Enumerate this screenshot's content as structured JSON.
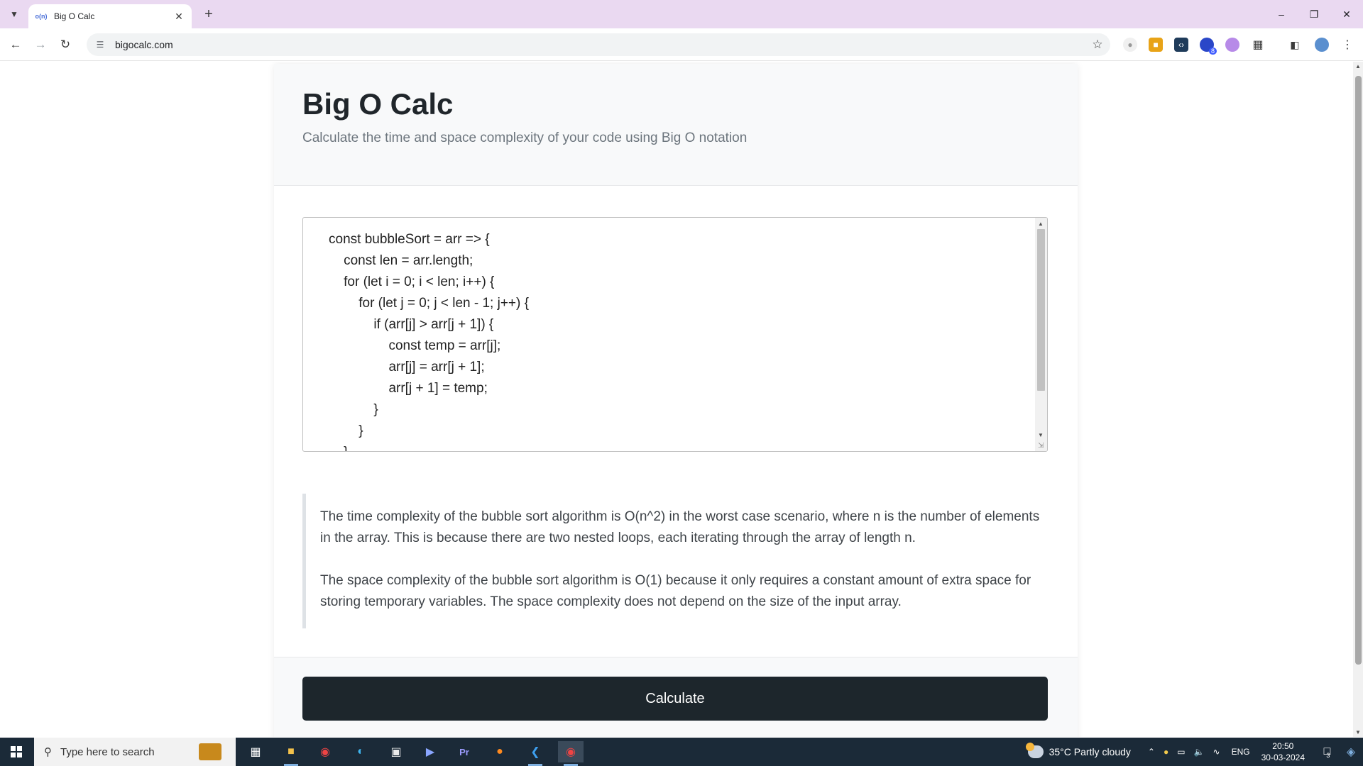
{
  "browser": {
    "tab_title": "Big O Calc",
    "tab_favicon": "o(n)",
    "url": "bigocalc.com",
    "icons": {
      "tab_search": "chevron-down-icon",
      "tab_close": "close-icon",
      "new_tab": "plus-icon",
      "back": "arrow-left-icon",
      "forward": "arrow-right-icon",
      "reload": "reload-icon",
      "site_info": "tune-icon",
      "bookmark": "star-icon"
    },
    "extension_badge": "8"
  },
  "page": {
    "title": "Big O Calc",
    "subtitle": "Calculate the time and space complexity of your code using Big O notation",
    "code_lines": [
      "const bubbleSort = arr => {",
      "    const len = arr.length;",
      "    for (let i = 0; i < len; i++) {",
      "        for (let j = 0; j < len - 1; j++) {",
      "            if (arr[j] > arr[j + 1]) {",
      "                const temp = arr[j];",
      "                arr[j] = arr[j + 1];",
      "                arr[j + 1] = temp;",
      "            }",
      "        }",
      "    }"
    ],
    "result_paragraphs": [
      "The time complexity of the bubble sort algorithm is O(n^2) in the worst case scenario, where n is the number of elements in the array. This is because there are two nested loops, each iterating through the array of length n.",
      "The space complexity of the bubble sort algorithm is O(1) because it only requires a constant amount of extra space for storing temporary variables. The space complexity does not depend on the size of the input array."
    ],
    "calculate_label": "Calculate"
  },
  "taskbar": {
    "search_placeholder": "Type here to search",
    "weather": "35°C  Partly cloudy",
    "language": "ENG",
    "time": "20:50",
    "date": "30-03-2024",
    "notification_count": "3"
  },
  "colors": {
    "tab_strip": "#ead9f1",
    "button_dark": "#1d262c",
    "taskbar": "#1b2a38"
  }
}
